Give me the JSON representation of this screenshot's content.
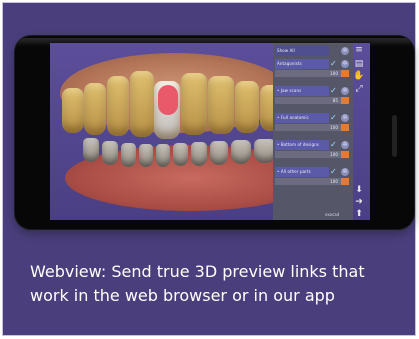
{
  "panel": {
    "header": "Show All",
    "items": [
      {
        "label": "Antagonists",
        "value": "100"
      },
      {
        "label": "• Jaw scans",
        "value": "85"
      },
      {
        "label": "• Full anatomic",
        "value": "100"
      },
      {
        "label": "• Bottom of designs",
        "value": "100"
      },
      {
        "label": "• All other parts",
        "value": "100"
      }
    ],
    "brand": "exocad"
  },
  "caption": "Webview: Send true 3D preview links that work in the web browser or in our app",
  "colors": {
    "background": "#4a3f7c",
    "screen": "#5c4e9a",
    "panel": "#555768",
    "panel_label": "#5a5aa8",
    "slider_accent": "#e07c34",
    "crown_highlight": "#e85a6a"
  }
}
